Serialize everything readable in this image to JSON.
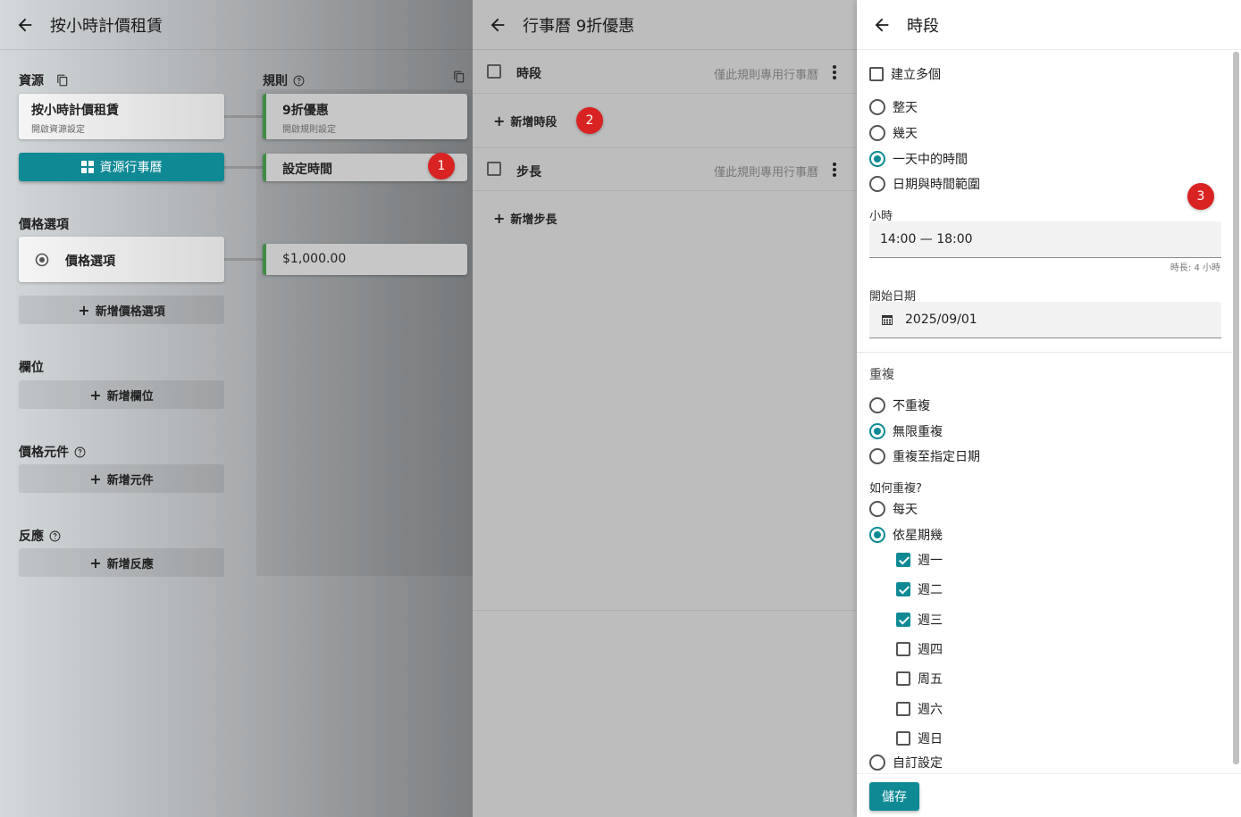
{
  "panel1": {
    "title": "按小時計價租賃",
    "resources_label": "資源",
    "resource_card": {
      "title": "按小時計價租賃",
      "subtitle": "開啟資源設定"
    },
    "calendar_button": "資源行事曆",
    "rules_label": "規則",
    "rule_discount": {
      "title": "9折優惠",
      "subtitle": "開啟規則設定"
    },
    "rule_time": "設定時間",
    "price_options_label": "價格選項",
    "price_option_card": "價格選項",
    "price_value": "$1,000.00",
    "add_price_option": "新增價格選項",
    "fields_label": "欄位",
    "add_field": "新增欄位",
    "price_component_label": "價格元件",
    "add_component": "新增元件",
    "reaction_label": "反應",
    "add_reaction": "新增反應",
    "badge": "1"
  },
  "panel2": {
    "title": "行事曆 9折優惠",
    "rows": [
      {
        "label": "時段",
        "hint": "僅此規則專用行事曆"
      },
      {
        "label": "步長",
        "hint": "僅此規則專用行事曆"
      }
    ],
    "add_slot": "新增時段",
    "add_step": "新增步長",
    "badge": "2"
  },
  "panel3": {
    "title": "時段",
    "create_multiple": "建立多個",
    "mode_options": [
      "整天",
      "幾天",
      "一天中的時間",
      "日期與時間範圍"
    ],
    "mode_selected": "一天中的時間",
    "badge": "3",
    "hours_label": "小時",
    "hours_value": "14:00 — 18:00",
    "duration_hint": "時長: 4 小時",
    "start_date_label": "開始日期",
    "start_date_value": "2025/09/01",
    "repeat_label": "重複",
    "repeat_options": [
      "不重複",
      "無限重複",
      "重複至指定日期"
    ],
    "repeat_selected": "無限重複",
    "how_label": "如何重複?",
    "how_options": [
      "每天",
      "依星期幾"
    ],
    "how_selected": "依星期幾",
    "weekdays": [
      {
        "label": "週一",
        "checked": true
      },
      {
        "label": "週二",
        "checked": true
      },
      {
        "label": "週三",
        "checked": true
      },
      {
        "label": "週四",
        "checked": false
      },
      {
        "label": "周五",
        "checked": false
      },
      {
        "label": "週六",
        "checked": false
      },
      {
        "label": "週日",
        "checked": false
      }
    ],
    "custom_option": "自訂設定",
    "save": "儲存"
  },
  "colors": {
    "accent": "#0f8a95",
    "badge": "#d92323",
    "rule_bar": "#3f8d45"
  }
}
